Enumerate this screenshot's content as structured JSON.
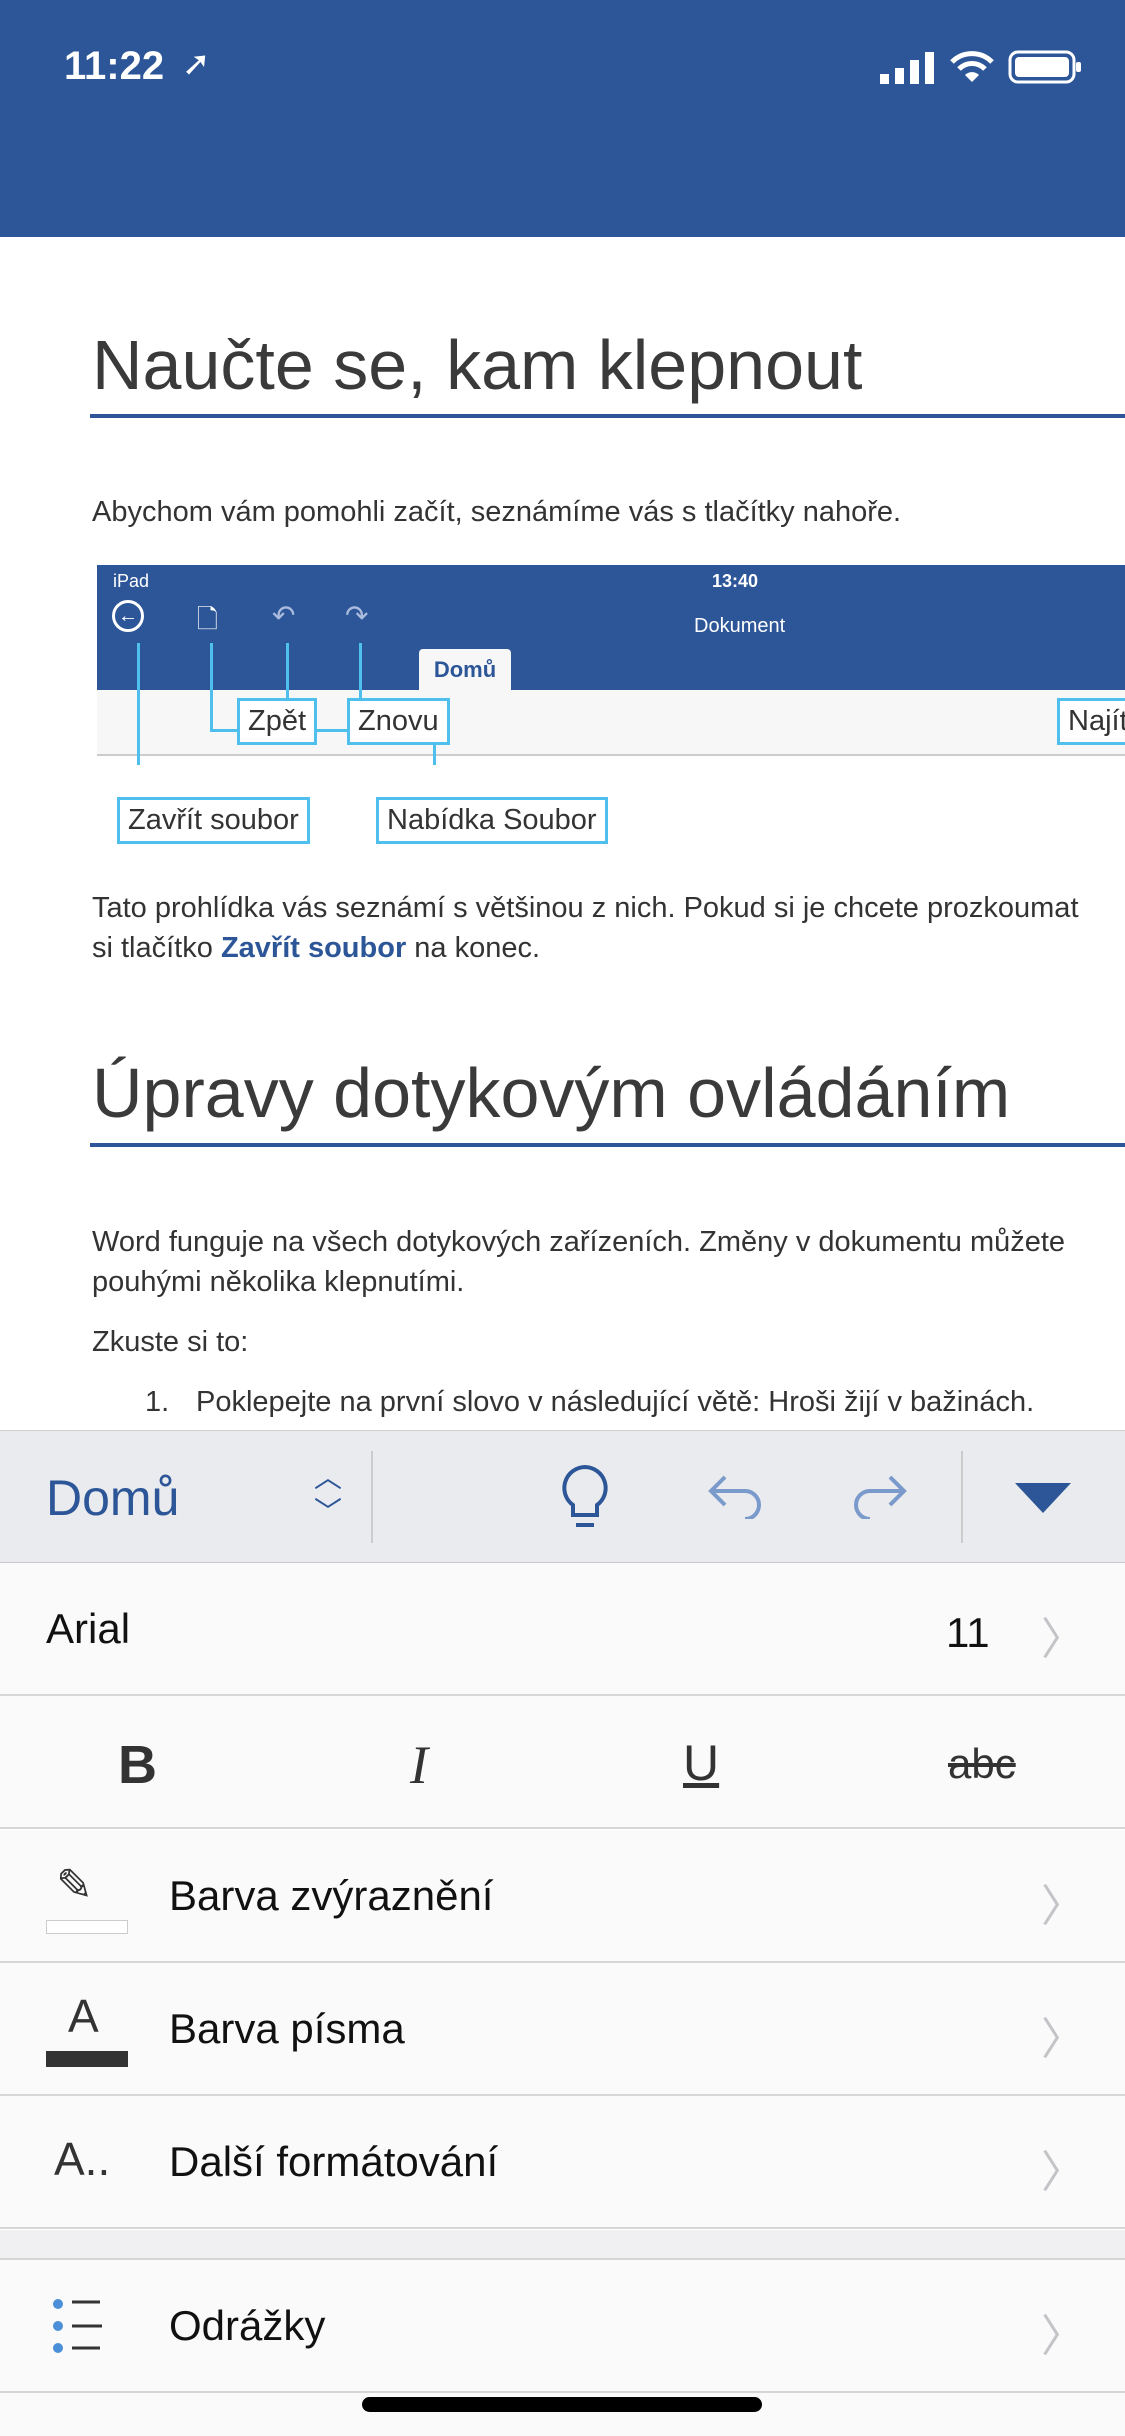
{
  "status_bar": {
    "time": "11:22"
  },
  "document": {
    "heading1": "Naučte se, kam klepnout",
    "intro": "Abychom vám pomohli začít, seznámíme vás s tlačítky nahoře.",
    "screenshot": {
      "device": "iPad",
      "time": "13:40",
      "title": "Dokument",
      "tab": "Domů",
      "callouts": {
        "undo": "Zpět",
        "redo": "Znovu",
        "find": "Najít",
        "close": "Zavřít soubor",
        "file_menu": "Nabídka Soubor"
      }
    },
    "para2_line1": "Tato prohlídka vás seznámí s většinou z nich. Pokud si je chcete prozkoumat",
    "para2_line2_a": "si tlačítko ",
    "para2_link": "Zavřít soubor",
    "para2_line2_b": " na konec.",
    "heading2": "Úpravy dotykovým ovládáním",
    "para3_line1": "Word funguje na všech dotykových zařízeních. Změny v dokumentu můžete",
    "para3_line2": "pouhými několika klepnutími.",
    "try": "Zkuste si to:",
    "list_item_num": "1.",
    "list_item": "Poklepejte na první slovo v následující větě: Hroši žijí v bažinách."
  },
  "toolbar": {
    "tab": "Domů"
  },
  "panel": {
    "font": "Arial",
    "size": "11",
    "bold": "B",
    "italic": "I",
    "underline": "U",
    "strike": "abc",
    "highlight": "Barva zvýraznění",
    "font_color": "Barva písma",
    "more": "Další formátování",
    "bullets": "Odrážky"
  },
  "colors": {
    "brand": "#2C5697",
    "callout": "#4FC0EE"
  }
}
